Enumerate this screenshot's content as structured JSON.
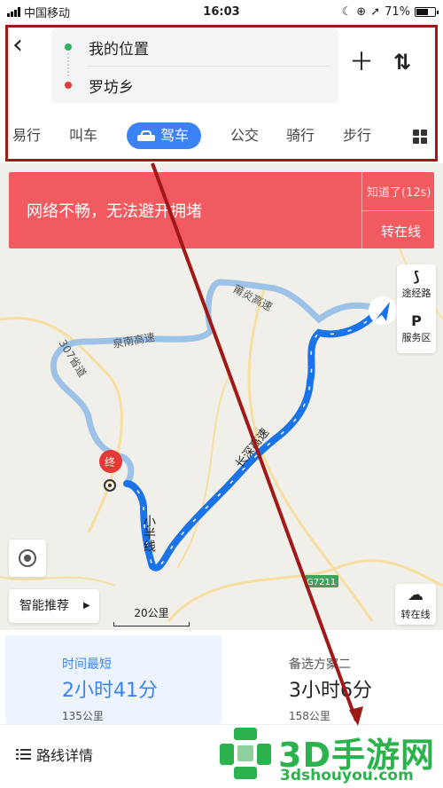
{
  "status_bar": {
    "carrier": "中国移动",
    "time": "16:03",
    "battery": "71%",
    "battery_level": 0.71
  },
  "search": {
    "origin": "我的位置",
    "destination": "罗坊乡"
  },
  "tabs": [
    {
      "label": "易行"
    },
    {
      "label": "叫车"
    },
    {
      "label": "驾车",
      "active": true
    },
    {
      "label": "公交"
    },
    {
      "label": "骑行"
    },
    {
      "label": "步行"
    }
  ],
  "banner": {
    "message": "网络不畅，无法避开拥堵",
    "dismiss": "知道了(12s)",
    "switch_online": "转在线"
  },
  "map": {
    "road_labels": [
      "莆炎高速",
      "泉南高速",
      "307省道",
      "长深高速",
      "小半线",
      "G7211"
    ],
    "end_marker": "终",
    "scale": "20公里",
    "route_color": "#1a73e8",
    "alt_route_color": "#9cc2e8"
  },
  "side_buttons": {
    "waypoint": "途经路",
    "service": "服务区",
    "service_icon": "P"
  },
  "map_controls": {
    "smart_recommend": "智能推荐",
    "turn_online": "转在线"
  },
  "routes": [
    {
      "label": "时间最短",
      "duration": "2小时41分",
      "distance": "135公里"
    },
    {
      "label": "备选方案二",
      "duration": "3小时6分",
      "distance": "158公里"
    }
  ],
  "detail_label": "路线详情",
  "watermark": {
    "title": "3D手游网",
    "url": "3dshouyou.com"
  },
  "colors": {
    "accent": "#3b83f4",
    "banner": "#f15a5f",
    "annotation": "#a01818",
    "watermark": "#2bb24c"
  }
}
